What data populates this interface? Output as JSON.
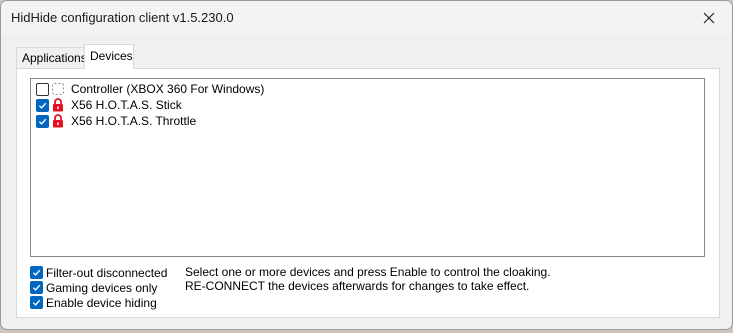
{
  "window": {
    "title": "HidHide configuration client v1.5.230.0"
  },
  "tabs": [
    {
      "label": "Applications",
      "selected": false
    },
    {
      "label": "Devices",
      "selected": true
    }
  ],
  "devices": [
    {
      "label": "Controller (XBOX 360 For Windows)",
      "checked": false,
      "icon": "controller-placeholder-icon"
    },
    {
      "label": "X56 H.O.T.A.S. Stick",
      "checked": true,
      "icon": "lock-icon"
    },
    {
      "label": "X56 H.O.T.A.S. Throttle",
      "checked": true,
      "icon": "lock-icon"
    }
  ],
  "options": [
    {
      "label": "Filter-out disconnected",
      "checked": true
    },
    {
      "label": "Gaming devices only",
      "checked": true
    },
    {
      "label": "Enable device hiding",
      "checked": true
    }
  ],
  "help": {
    "line1": "Select one or more devices and press Enable to control the cloaking.",
    "line2": "RE-CONNECT the devices afterwards for changes to take effect."
  },
  "colors": {
    "accent": "#0067c0",
    "lock": "#e81123"
  }
}
